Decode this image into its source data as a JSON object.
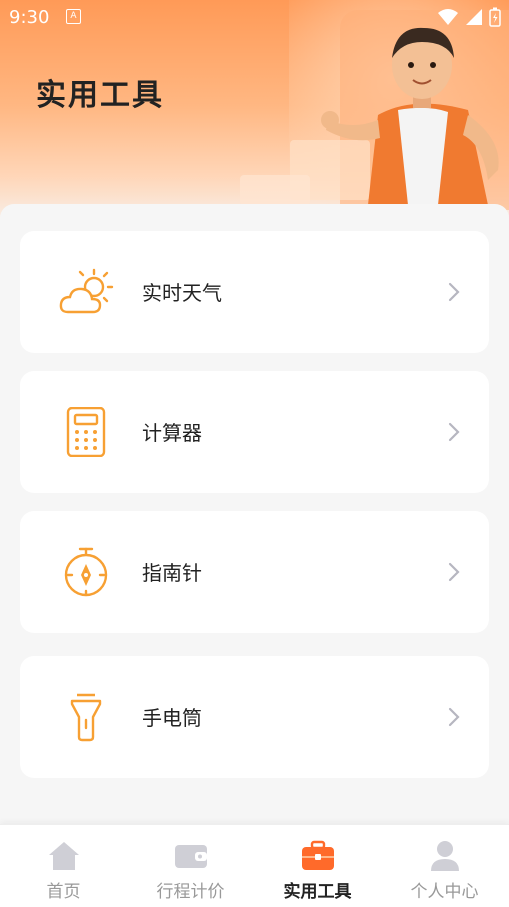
{
  "status": {
    "time": "9:30",
    "notif": "A"
  },
  "header": {
    "title": "实用工具"
  },
  "tools": [
    {
      "label": "实时天气",
      "icon": "weather-icon"
    },
    {
      "label": "计算器",
      "icon": "calculator-icon"
    },
    {
      "label": "指南针",
      "icon": "compass-icon"
    },
    {
      "label": "手电筒",
      "icon": "flashlight-icon"
    }
  ],
  "tabbar": {
    "items": [
      {
        "label": "首页",
        "icon": "home-icon"
      },
      {
        "label": "行程计价",
        "icon": "wallet-icon"
      },
      {
        "label": "实用工具",
        "icon": "toolbox-icon",
        "active": true
      },
      {
        "label": "个人中心",
        "icon": "user-icon"
      }
    ]
  },
  "colors": {
    "accent": "#ff8a2a",
    "icon_orange": "#f7a033",
    "tab_active_icon": "#ff6a2a",
    "tab_inactive_icon": "#cfcfd6"
  }
}
